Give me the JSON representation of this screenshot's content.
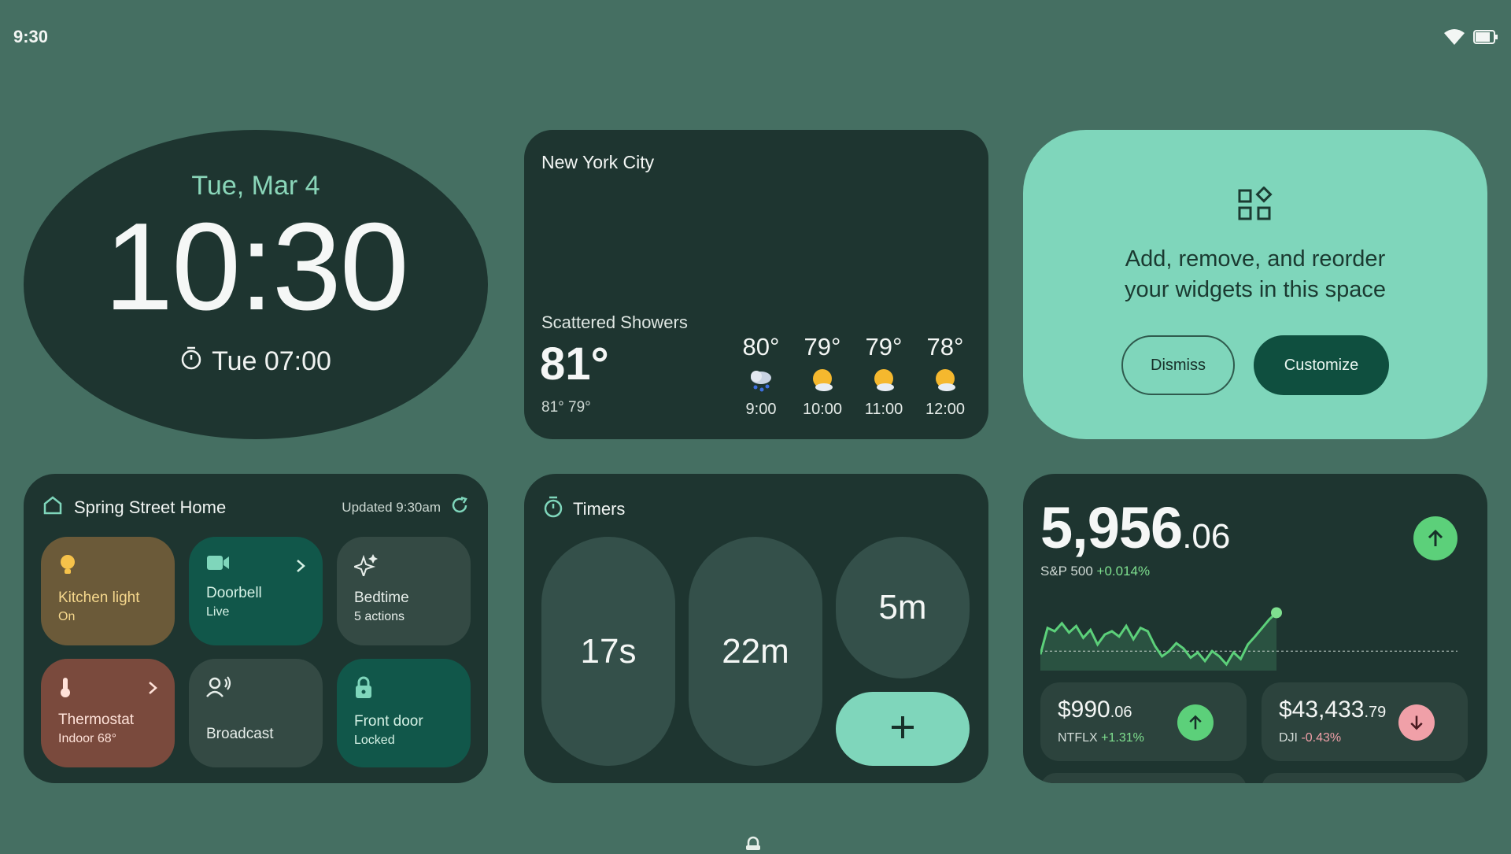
{
  "status": {
    "time": "9:30"
  },
  "clock": {
    "date": "Tue, Mar 4",
    "time": "10:30",
    "alarm": "Tue 07:00"
  },
  "weather": {
    "city": "New York City",
    "condition": "Scattered Showers",
    "temp": "81°",
    "hilo": "81°  79°",
    "hours": [
      {
        "temp": "80°",
        "icon": "rain-cloud-icon",
        "time": "9:00"
      },
      {
        "temp": "79°",
        "icon": "partly-sunny-icon",
        "time": "10:00"
      },
      {
        "temp": "79°",
        "icon": "partly-sunny-icon",
        "time": "11:00"
      },
      {
        "temp": "78°",
        "icon": "partly-sunny-icon",
        "time": "12:00"
      }
    ]
  },
  "customize": {
    "line1": "Add, remove, and reorder",
    "line2": "your widgets in this space",
    "dismiss": "Dismiss",
    "customize": "Customize"
  },
  "home": {
    "title": "Spring Street Home",
    "updated": "Updated 9:30am",
    "tiles": [
      {
        "name": "Kitchen light",
        "status": "On",
        "icon": "lightbulb-icon"
      },
      {
        "name": "Doorbell",
        "status": "Live",
        "icon": "camera-icon"
      },
      {
        "name": "Bedtime",
        "status": "5 actions",
        "icon": "sparkle-icon"
      },
      {
        "name": "Thermostat",
        "status": "Indoor 68°",
        "icon": "thermometer-icon"
      },
      {
        "name": "Broadcast",
        "status": "",
        "icon": "broadcast-icon"
      },
      {
        "name": "Front door",
        "status": "Locked",
        "icon": "lock-icon"
      }
    ]
  },
  "timers": {
    "title": "Timers",
    "items": [
      "17s",
      "22m",
      "5m"
    ]
  },
  "stocks": {
    "main": {
      "int": "5,956",
      "dec": ".06",
      "name": "S&P 500",
      "change": "+0.014%"
    },
    "chart_data": {
      "type": "line",
      "series": [
        {
          "values": [
            0.15,
            0.55,
            0.5,
            0.62,
            0.48,
            0.58,
            0.4,
            0.52,
            0.3,
            0.45,
            0.5,
            0.42,
            0.58,
            0.38,
            0.55,
            0.5,
            0.28,
            0.12,
            0.2,
            0.32,
            0.24,
            0.1,
            0.18,
            0.05,
            0.2,
            0.12,
            0.0,
            0.18,
            0.08,
            0.3,
            0.42,
            0.55,
            0.68,
            0.78
          ]
        }
      ],
      "baseline": 0.2,
      "ylim": [
        0,
        1
      ]
    },
    "minis": [
      {
        "int": "$990",
        "dec": ".06",
        "name": "NTFLX",
        "change": "+1.31%",
        "dir": "up"
      },
      {
        "int": "$43,433",
        "dec": ".79",
        "name": "DJI",
        "change": "-0.43%",
        "dir": "down"
      }
    ]
  },
  "colors": {
    "background": "#456f62",
    "card": "#1e3530",
    "accent": "#7fd6bb",
    "up": "#5cd07a",
    "down": "#f0a0a8"
  }
}
